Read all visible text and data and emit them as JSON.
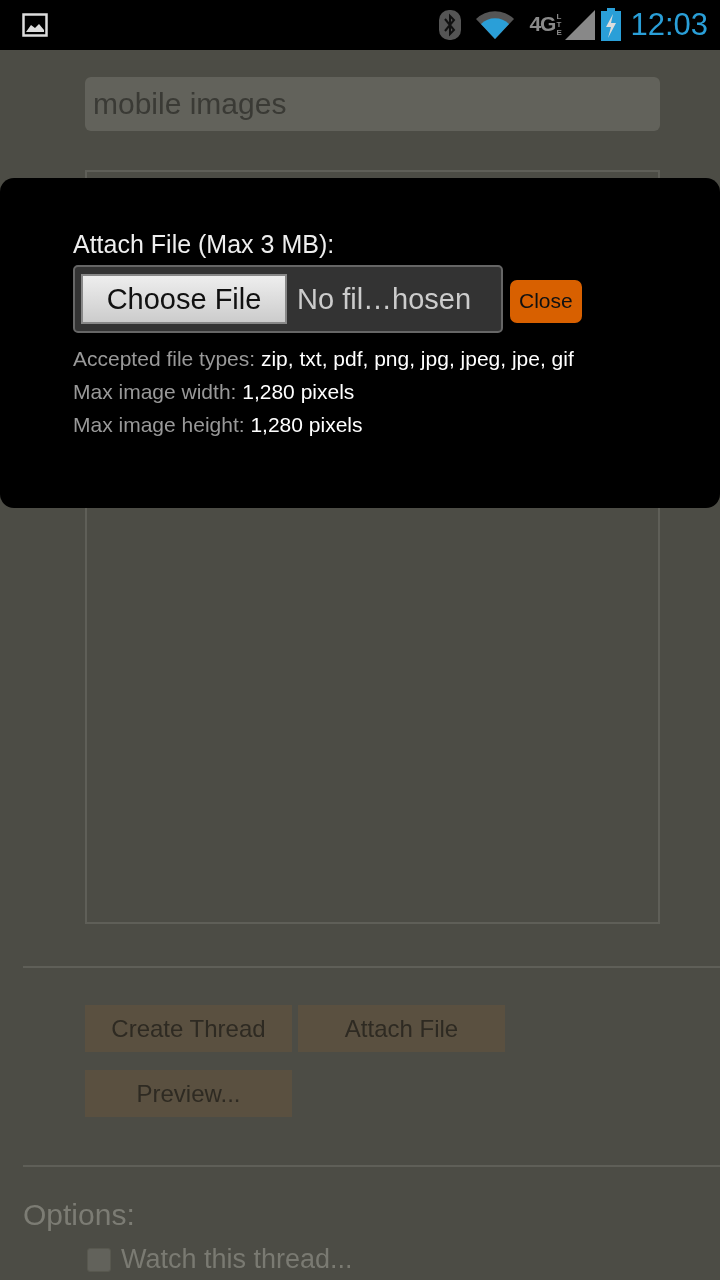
{
  "status_bar": {
    "network": "4G",
    "network_sub": "LTE",
    "time": "12:03"
  },
  "form": {
    "title_field": {
      "value": "mobile images"
    },
    "buttons": [
      {
        "label": "Create Thread"
      },
      {
        "label": "Attach File"
      },
      {
        "label": "Preview..."
      }
    ],
    "options": {
      "heading": "Options:",
      "items": [
        {
          "label": "Watch this thread...",
          "checked": false
        }
      ]
    }
  },
  "attach_dialog": {
    "heading": "Attach File (Max 3 MB):",
    "choose_button": "Choose File",
    "file_status": "No fil…hosen",
    "close_button": "Close",
    "info": [
      {
        "label": "Accepted file types:",
        "value": "zip, txt, pdf, png, jpg, jpeg, jpe, gif"
      },
      {
        "label": "Max image width:",
        "value": "1,280 pixels"
      },
      {
        "label": "Max image height:",
        "value": "1,280 pixels"
      }
    ]
  }
}
